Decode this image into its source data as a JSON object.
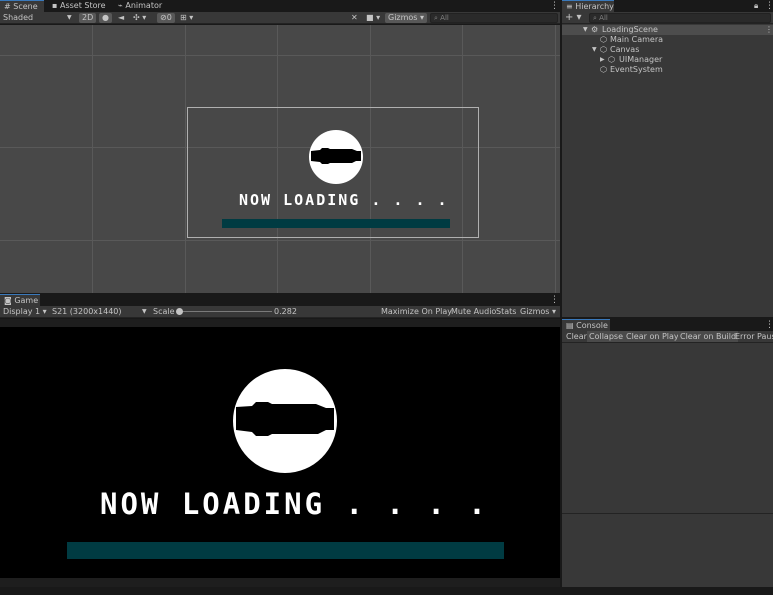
{
  "scene_tabs": {
    "scene": "Scene",
    "asset_store": "Asset Store",
    "animator": "Animator"
  },
  "scene_toolbar": {
    "shading_mode": "Shaded",
    "mode_2d": "2D",
    "hidden_count": "0",
    "gizmos": "Gizmos",
    "search_placeholder": "All"
  },
  "canvas_content": {
    "loading_text": "NOW LOADING . . . .",
    "bar_color": "#003b42"
  },
  "game": {
    "tab_label": "Game",
    "display": "Display 1",
    "resolution": "S21 (3200x1440)",
    "scale_label": "Scale",
    "scale_value": "0.282",
    "maximize_on_play": "Maximize On Play",
    "mute_audio": "Mute Audio",
    "stats": "Stats",
    "gizmos": "Gizmos"
  },
  "hierarchy": {
    "tab_label": "Hierarchy",
    "search_placeholder": "All",
    "items": [
      {
        "label": "LoadingScene"
      },
      {
        "label": "Main Camera"
      },
      {
        "label": "Canvas"
      },
      {
        "label": "UIManager"
      },
      {
        "label": "EventSystem"
      }
    ]
  },
  "console": {
    "tab_label": "Console",
    "buttons": [
      "Clear",
      "Collapse",
      "Clear on Play",
      "Clear on Build",
      "Error Pause"
    ]
  },
  "colors": {
    "accent": "#3a79bb",
    "panel": "#383838",
    "scene_bg": "#484848",
    "game_bg": "#000000",
    "loading_bar": "#003b42"
  }
}
